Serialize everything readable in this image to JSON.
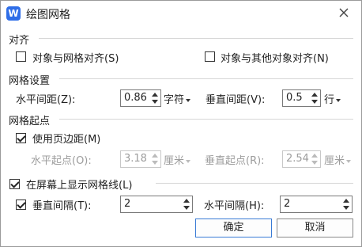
{
  "dialog": {
    "title": "绘图网格",
    "app_icon_letter": "W"
  },
  "align": {
    "section": "对齐",
    "snap_to_grid": {
      "label": "对象与网格对齐(S)",
      "checked": false
    },
    "snap_to_objects": {
      "label": "对象与其他对象对齐(N)",
      "checked": false
    }
  },
  "grid_settings": {
    "section": "网格设置",
    "horizontal_spacing": {
      "label": "水平间距(Z):",
      "value": "0.86",
      "unit": "字符"
    },
    "vertical_spacing": {
      "label": "垂直间距(V):",
      "value": "0.5",
      "unit": "行"
    }
  },
  "grid_origin": {
    "section": "网格起点",
    "use_margins": {
      "label": "使用页边距(M)",
      "checked": true
    },
    "horizontal_origin": {
      "label": "水平起点(O):",
      "value": "3.18",
      "unit": "厘米"
    },
    "vertical_origin": {
      "label": "垂直起点(R):",
      "value": "2.54",
      "unit": "厘米"
    }
  },
  "display": {
    "show_gridlines": {
      "label": "在屏幕上显示网格线(L)",
      "checked": true
    },
    "vertical_every": {
      "label": "垂直间隔(T):",
      "checked": true,
      "value": "2"
    },
    "horizontal_every": {
      "label": "水平间隔(H):",
      "value": "2"
    }
  },
  "buttons": {
    "ok": "确定",
    "cancel": "取消"
  }
}
